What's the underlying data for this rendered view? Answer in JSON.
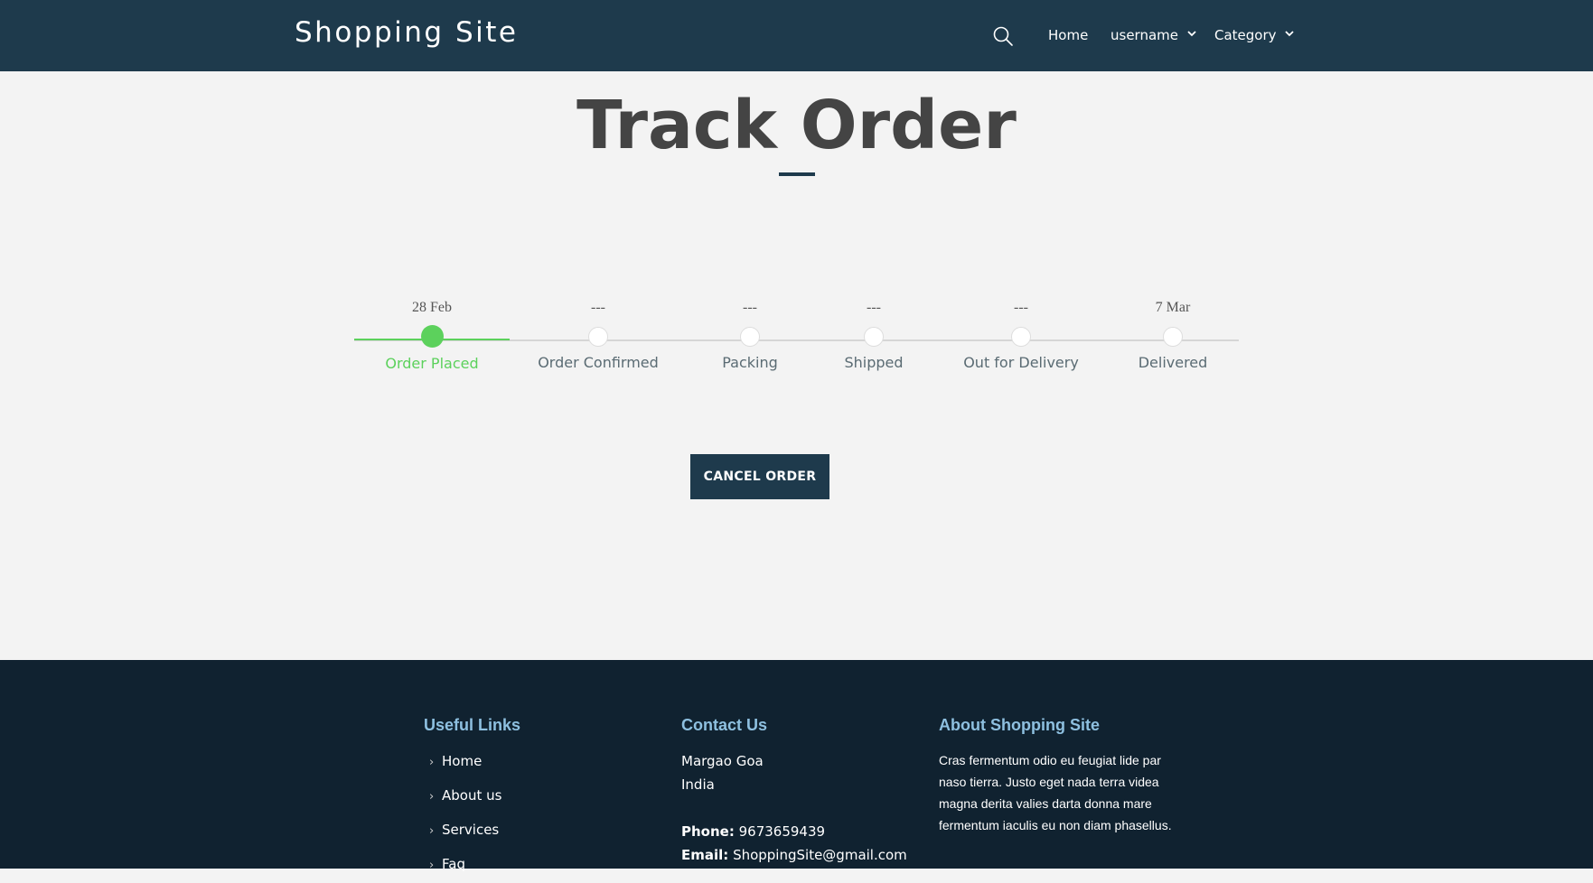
{
  "header": {
    "brand": "Shopping Site",
    "nav": {
      "home": "Home",
      "user": "username",
      "category": "Category"
    }
  },
  "page": {
    "title": "Track Order"
  },
  "tracker": {
    "steps": [
      {
        "date": "28 Feb",
        "label": "Order Placed",
        "done": true
      },
      {
        "date": "---",
        "label": "Order Confirmed",
        "done": false
      },
      {
        "date": "---",
        "label": "Packing",
        "done": false
      },
      {
        "date": "---",
        "label": "Shipped",
        "done": false
      },
      {
        "date": "---",
        "label": "Out for Delivery",
        "done": false
      },
      {
        "date": "7 Mar",
        "label": "Delivered",
        "done": false
      }
    ],
    "active_color": "#5cd15c"
  },
  "actions": {
    "cancel_label": "CANCEL ORDER"
  },
  "footer": {
    "links": {
      "heading": "Useful Links",
      "items": [
        "Home",
        "About us",
        "Services",
        "Faq"
      ]
    },
    "contact": {
      "heading": "Contact Us",
      "address_line1": "Margao Goa",
      "address_line2": "India",
      "phone_label": "Phone:",
      "phone": "9673659439",
      "email_label": "Email:",
      "email": "ShoppingSite@gmail.com"
    },
    "about": {
      "heading": "About Shopping Site",
      "text": "Cras fermentum odio eu feugiat lide par naso tierra. Justo eget nada terra videa magna derita valies darta donna mare fermentum iaculis eu non diam phasellus."
    }
  },
  "colors": {
    "header_bg": "#1e3a4c",
    "footer_bg": "#102230",
    "accent": "#5cd15c",
    "footer_heading": "#8ec0e0"
  }
}
